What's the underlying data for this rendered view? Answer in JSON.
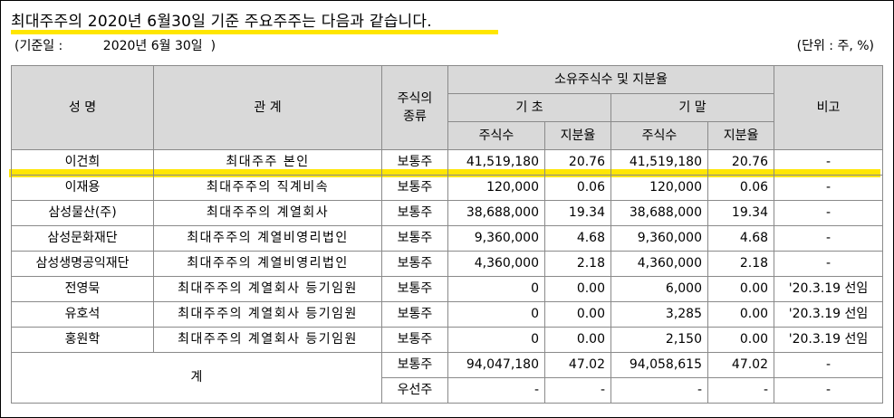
{
  "title": "최대주주의 2020년 6월30일 기준  주요주주는 다음과 같습니다.",
  "base_date_label": "(기준일 :",
  "base_date_value": "2020년 6월 30일  )",
  "unit_label": "(단위 : 주, %)",
  "highlight_color": "#ffe600",
  "header_color": "#d9d9d9",
  "headers": {
    "name": "성 명",
    "relation": "관 계",
    "stock_kind": "주식의\n종류",
    "holdings": "소유주식수 및 지분율",
    "beginning": "기 초",
    "ending": "기 말",
    "shares": "주식수",
    "ratio": "지분율",
    "note": "비고"
  },
  "rows": [
    {
      "name": "이건희",
      "relation": "최대주주 본인",
      "kind": "보통주",
      "begin_shares": "41,519,180",
      "begin_ratio": "20.76",
      "end_shares": "41,519,180",
      "end_ratio": "20.76",
      "note": "-"
    },
    {
      "name": "이재용",
      "relation": "최대주주의 직계비속",
      "kind": "보통주",
      "begin_shares": "120,000",
      "begin_ratio": "0.06",
      "end_shares": "120,000",
      "end_ratio": "0.06",
      "note": "-"
    },
    {
      "name": "삼성물산(주)",
      "relation": "최대주주의 계열회사",
      "kind": "보통주",
      "begin_shares": "38,688,000",
      "begin_ratio": "19.34",
      "end_shares": "38,688,000",
      "end_ratio": "19.34",
      "note": "-"
    },
    {
      "name": "삼성문화재단",
      "relation": "최대주주의 계열비영리법인",
      "kind": "보통주",
      "begin_shares": "9,360,000",
      "begin_ratio": "4.68",
      "end_shares": "9,360,000",
      "end_ratio": "4.68",
      "note": "-"
    },
    {
      "name": "삼성생명공익재단",
      "relation": "최대주주의 계열비영리법인",
      "kind": "보통주",
      "begin_shares": "4,360,000",
      "begin_ratio": "2.18",
      "end_shares": "4,360,000",
      "end_ratio": "2.18",
      "note": "-"
    },
    {
      "name": "전영묵",
      "relation": "최대주주의 계열회사 등기임원",
      "kind": "보통주",
      "begin_shares": "0",
      "begin_ratio": "0.00",
      "end_shares": "6,000",
      "end_ratio": "0.00",
      "note": "'20.3.19 선임"
    },
    {
      "name": "유호석",
      "relation": "최대주주의 계열회사 등기임원",
      "kind": "보통주",
      "begin_shares": "0",
      "begin_ratio": "0.00",
      "end_shares": "3,285",
      "end_ratio": "0.00",
      "note": "'20.3.19 선임"
    },
    {
      "name": "홍원학",
      "relation": "최대주주의 계열회사 등기임원",
      "kind": "보통주",
      "begin_shares": "0",
      "begin_ratio": "0.00",
      "end_shares": "2,150",
      "end_ratio": "0.00",
      "note": "'20.3.19 선임"
    }
  ],
  "total": {
    "label": "계",
    "rows": [
      {
        "kind": "보통주",
        "begin_shares": "94,047,180",
        "begin_ratio": "47.02",
        "end_shares": "94,058,615",
        "end_ratio": "47.02",
        "note": "-"
      },
      {
        "kind": "우선주",
        "begin_shares": "-",
        "begin_ratio": "-",
        "end_shares": "-",
        "end_ratio": "-",
        "note": "-"
      }
    ]
  }
}
